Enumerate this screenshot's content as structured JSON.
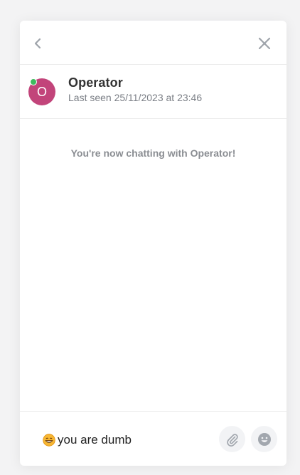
{
  "header": {
    "back_icon": "chevron-left-icon",
    "close_icon": "close-icon"
  },
  "agent": {
    "avatar_initial": "O",
    "name": "Operator",
    "last_seen": "Last seen 25/11/2023 at 23:46",
    "status": "online"
  },
  "conversation": {
    "system_message": "You're now chatting with Operator!"
  },
  "composer": {
    "emoji": "grinning-face-emoji",
    "text": "you are dumb",
    "attach_icon": "paperclip-icon",
    "emoji_picker_icon": "smiley-icon"
  },
  "colors": {
    "avatar_bg": "#c2447a",
    "online_dot": "#3dbb5d",
    "icon_gray": "#9ea3aa",
    "divider": "#ececec"
  }
}
